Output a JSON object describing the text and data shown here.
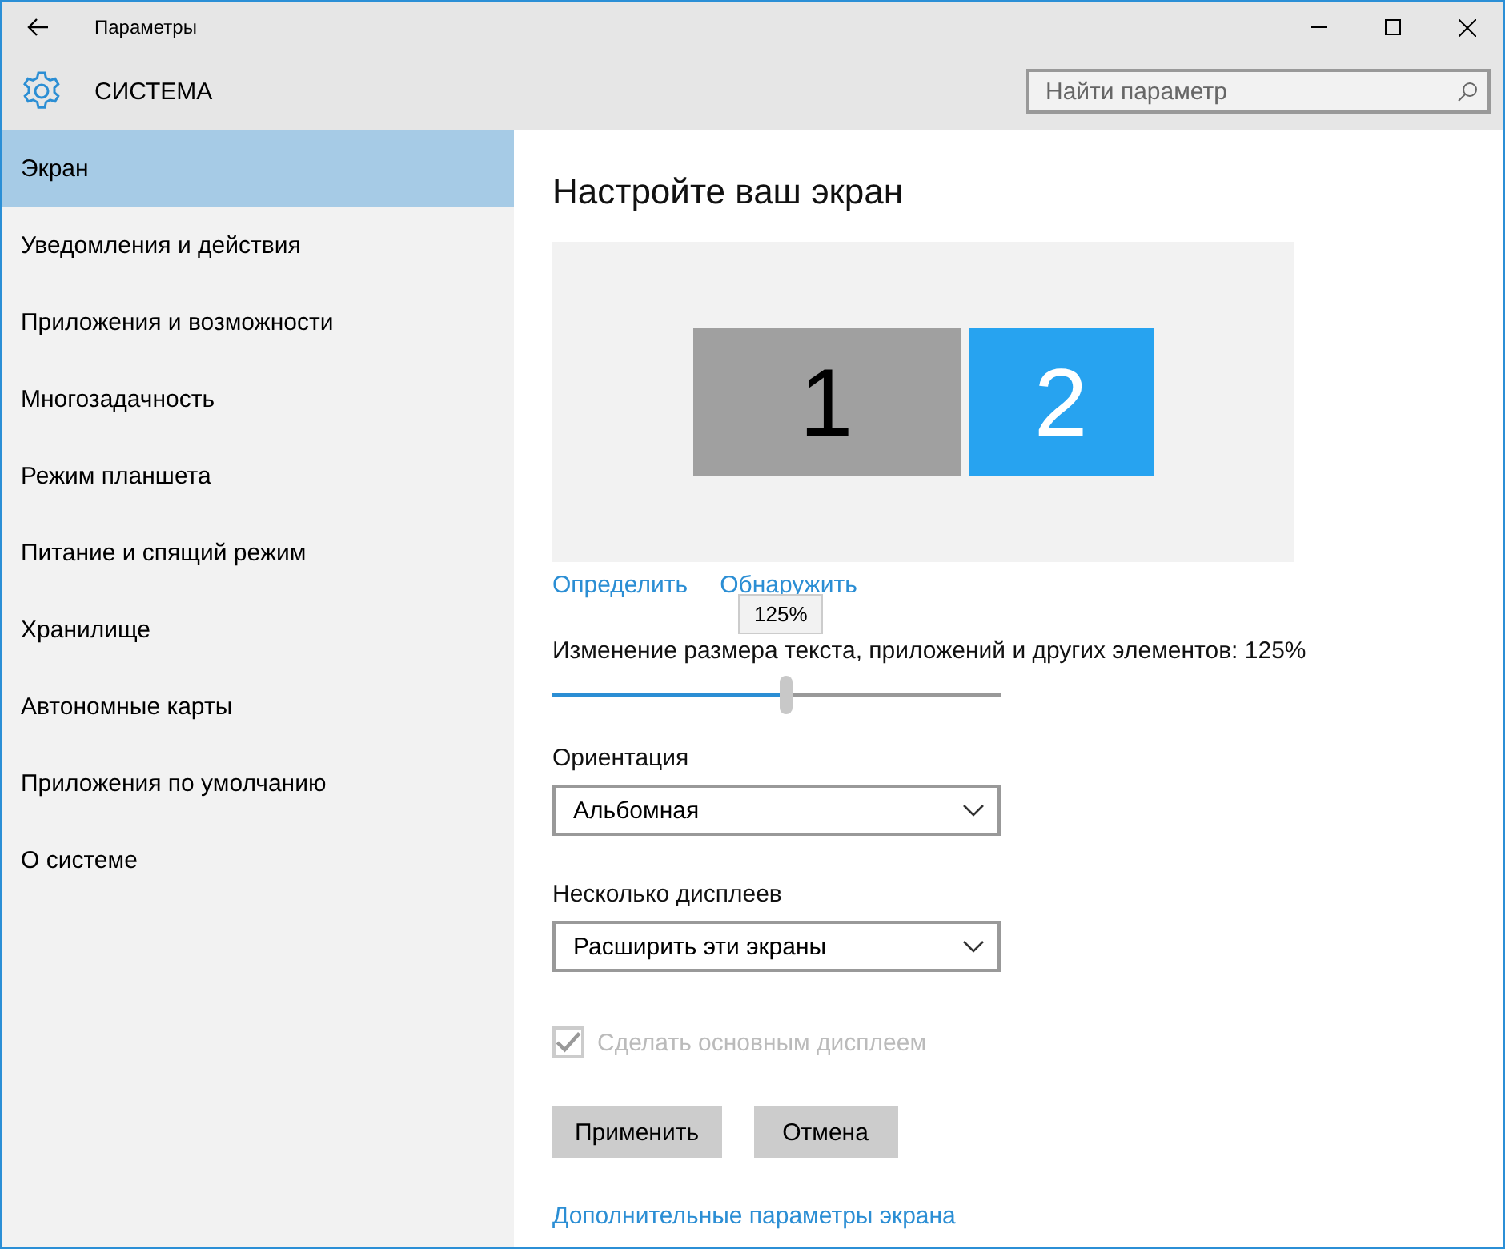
{
  "window": {
    "title": "Параметры"
  },
  "header": {
    "title": "СИСТЕМА",
    "search": {
      "placeholder": "Найти параметр"
    }
  },
  "sidebar": {
    "items": [
      {
        "label": "Экран",
        "selected": true
      },
      {
        "label": "Уведомления и действия",
        "selected": false
      },
      {
        "label": "Приложения и возможности",
        "selected": false
      },
      {
        "label": "Многозадачность",
        "selected": false
      },
      {
        "label": "Режим планшета",
        "selected": false
      },
      {
        "label": "Питание и спящий режим",
        "selected": false
      },
      {
        "label": "Хранилище",
        "selected": false
      },
      {
        "label": "Автономные карты",
        "selected": false
      },
      {
        "label": "Приложения по умолчанию",
        "selected": false
      },
      {
        "label": "О системе",
        "selected": false
      }
    ]
  },
  "content": {
    "title": "Настройте ваш экран",
    "displays": [
      {
        "label": "1",
        "selected": false
      },
      {
        "label": "2",
        "selected": true
      }
    ],
    "links": [
      "Определить",
      "Обнаружить"
    ],
    "scale": {
      "tooltip": "125%",
      "label": "Изменение размера текста, приложений и других элементов: 125%",
      "level": 0.52
    },
    "orientation": {
      "label": "Ориентация",
      "value": "Альбомная"
    },
    "multiple": {
      "label": "Несколько дисплеев",
      "value": "Расширить эти экраны"
    },
    "primary": {
      "label": "Сделать основным дисплеем",
      "checked": true,
      "disabled": true
    },
    "buttons": [
      "Применить",
      "Отмена"
    ],
    "advanced_link": "Дополнительные параметры экрана"
  }
}
